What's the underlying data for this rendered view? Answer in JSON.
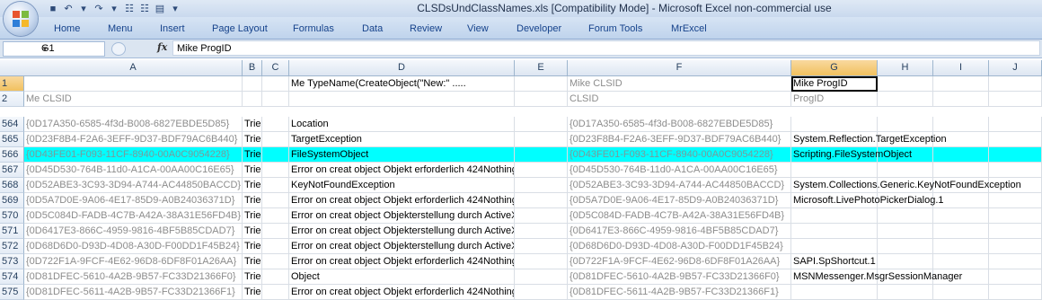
{
  "window": {
    "title": "CLSDsUndClassNames.xls  [Compatibility Mode] - Microsoft Excel non-commercial use"
  },
  "quick_access": [
    {
      "name": "save-icon",
      "glyph": "■"
    },
    {
      "name": "undo-icon",
      "glyph": "↶"
    },
    {
      "name": "undo-dropdown-icon",
      "glyph": "▾"
    },
    {
      "name": "redo-icon",
      "glyph": "↷"
    },
    {
      "name": "redo-dropdown-icon",
      "glyph": "▾"
    },
    {
      "name": "tree-icon",
      "glyph": "☷"
    },
    {
      "name": "tree2-icon",
      "glyph": "☷"
    },
    {
      "name": "form-icon",
      "glyph": "▤"
    },
    {
      "name": "customize-qat-icon",
      "glyph": "▾"
    }
  ],
  "ribbon_tabs": [
    "Home",
    "Menu",
    "Insert",
    "Page Layout",
    "Formulas",
    "Data",
    "Review",
    "View",
    "Developer",
    "Forum Tools",
    "MrExcel"
  ],
  "formula_bar": {
    "name_box": "G1",
    "fx": "fx",
    "formula": "Mike  ProgID"
  },
  "columns": [
    "A",
    "B",
    "C",
    "D",
    "E",
    "F",
    "G",
    "H",
    "I",
    "J"
  ],
  "selected_column": "G",
  "header_rows": [
    {
      "num": "1",
      "A": "",
      "D": "Me  TypeName(CreateObject(\"New:\" .....",
      "F": "Mike  CLSID",
      "G": "Mike  ProgID"
    },
    {
      "num": "2",
      "A": "Me   CLSID",
      "F": "CLSID",
      "G": "ProgID"
    }
  ],
  "rows": [
    {
      "num": "564",
      "A": "{0D17A350-6585-4f3d-B008-6827EBDE5D85}",
      "B": "Tried",
      "D": "Location",
      "F": "{0D17A350-6585-4f3d-B008-6827EBDE5D85}",
      "G": ""
    },
    {
      "num": "565",
      "A": "{0D23F8B4-F2A6-3EFF-9D37-BDF79AC6B440}",
      "B": "Tried",
      "D": "TargetException",
      "F": "{0D23F8B4-F2A6-3EFF-9D37-BDF79AC6B440}",
      "G": "System.Reflection.TargetException"
    },
    {
      "num": "566",
      "A": "{0D43FE01-F093-11CF-8940-00A0C9054228}",
      "B": "Tried",
      "D": "FileSystemObject",
      "F": "{0D43FE01-F093-11CF-8940-00A0C9054228}",
      "G": "Scripting.FileSystemObject",
      "highlight": true
    },
    {
      "num": "567",
      "A": "{0D45D530-764B-11d0-A1CA-00AA00C16E65}",
      "B": "Tried",
      "D": "Error on creat object   Objekt erforderlich  424Nothing",
      "F": "{0D45D530-764B-11d0-A1CA-00AA00C16E65}",
      "G": ""
    },
    {
      "num": "568",
      "A": "{0D52ABE3-3C93-3D94-A744-AC44850BACCD}",
      "B": "Tried",
      "D": "KeyNotFoundException",
      "F": "{0D52ABE3-3C93-3D94-A744-AC44850BACCD}",
      "G": "System.Collections.Generic.KeyNotFoundException"
    },
    {
      "num": "569",
      "A": "{0D5A7D0E-9A06-4E17-85D9-A0B24036371D}",
      "B": "Tried",
      "D": "Error on creat object   Objekt erforderlich  424Nothing",
      "F": "{0D5A7D0E-9A06-4E17-85D9-A0B24036371D}",
      "G": "Microsoft.LivePhotoPickerDialog.1"
    },
    {
      "num": "570",
      "A": "{0D5C084D-FADB-4C7B-A42A-38A31E56FD4B}",
      "B": "Tried",
      "D": "Error on creat object   Objekterstellung durch ActiveX-Kon",
      "F": "{0D5C084D-FADB-4C7B-A42A-38A31E56FD4B}",
      "G": ""
    },
    {
      "num": "571",
      "A": "{0D6417E3-866C-4959-9816-4BF5B85CDAD7}",
      "B": "Tried",
      "D": "Error on creat object   Objekterstellung durch ActiveX-Kon",
      "F": "{0D6417E3-866C-4959-9816-4BF5B85CDAD7}",
      "G": ""
    },
    {
      "num": "572",
      "A": "{0D68D6D0-D93D-4D08-A30D-F00DD1F45B24}",
      "B": "Tried",
      "D": "Error on creat object   Objekterstellung durch ActiveX-Kon",
      "F": "{0D68D6D0-D93D-4D08-A30D-F00DD1F45B24}",
      "G": ""
    },
    {
      "num": "573",
      "A": "{0D722F1A-9FCF-4E62-96D8-6DF8F01A26AA}",
      "B": "Tried",
      "D": "Error on creat object   Objekt erforderlich  424Nothing",
      "F": "{0D722F1A-9FCF-4E62-96D8-6DF8F01A26AA}",
      "G": "SAPI.SpShortcut.1"
    },
    {
      "num": "574",
      "A": "{0D81DFEC-5610-4A2B-9B57-FC33D21366F0}",
      "B": "Tried",
      "D": "Object",
      "F": "{0D81DFEC-5610-4A2B-9B57-FC33D21366F0}",
      "G": "MSNMessenger.MsgrSessionManager"
    },
    {
      "num": "575",
      "A": "{0D81DFEC-5611-4A2B-9B57-FC33D21366F1}",
      "B": "Tried",
      "D": "Error on creat object   Objekt erforderlich  424Nothing",
      "F": "{0D81DFEC-5611-4A2B-9B57-FC33D21366F1}",
      "G": ""
    }
  ],
  "colors": {
    "highlight": "#00ffff",
    "selected_header": "#f1c15f",
    "ribbon": "#bfd3ec"
  }
}
